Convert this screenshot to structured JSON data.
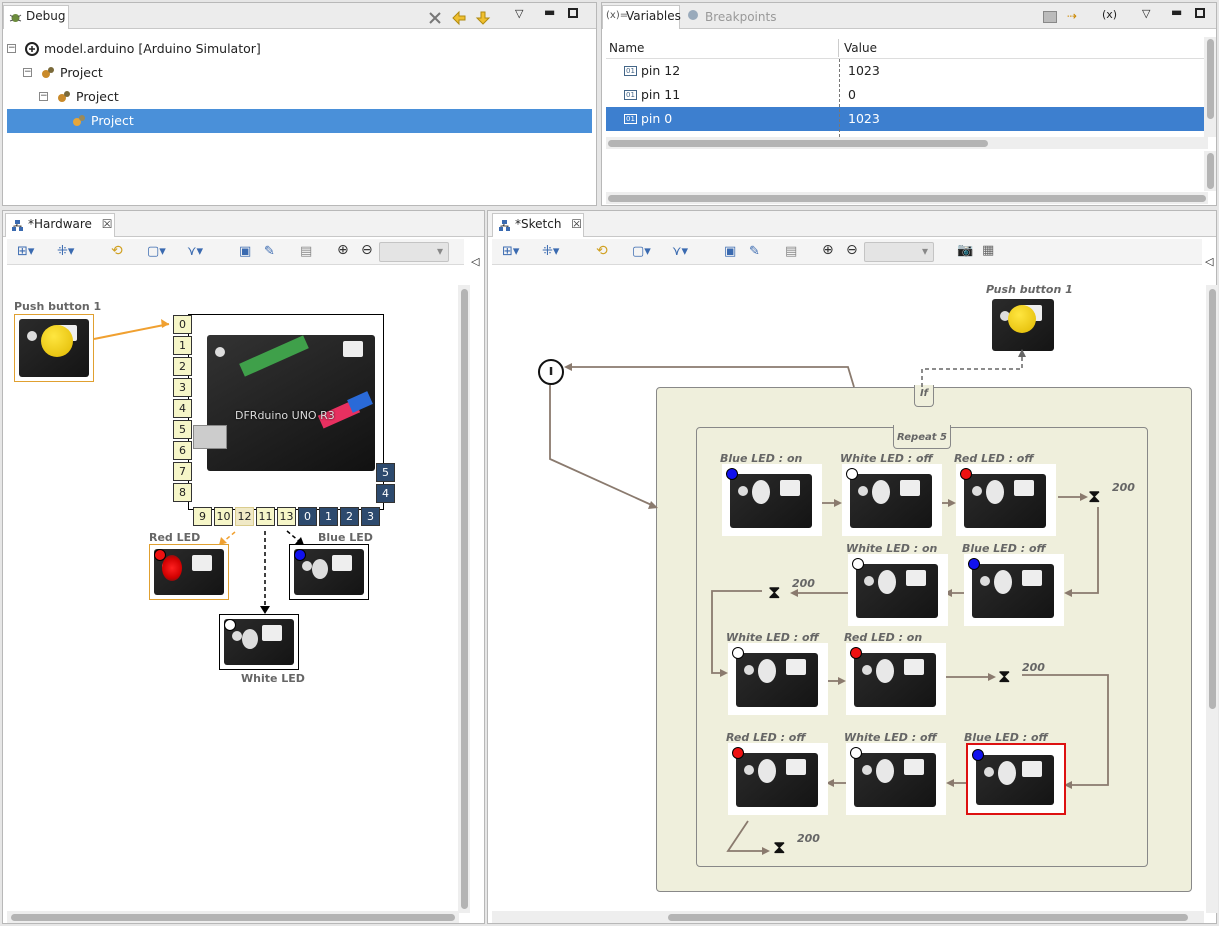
{
  "debug": {
    "tab_label": "Debug",
    "launch": "model.arduino [Arduino Simulator]",
    "tree": [
      "Project",
      "Project",
      "Project"
    ]
  },
  "variables": {
    "tab_label": "Variables",
    "tab2_label": "Breakpoints",
    "col_name": "Name",
    "col_value": "Value",
    "rows": [
      {
        "name": "pin 12",
        "value": "1023"
      },
      {
        "name": "pin 11",
        "value": "0"
      },
      {
        "name": "pin 0",
        "value": "1023"
      }
    ]
  },
  "hardware": {
    "tab_label": "*Hardware",
    "push_button": "Push button 1",
    "board_name": "DFRduino UNO R3",
    "left_pins": [
      "0",
      "1",
      "2",
      "3",
      "4",
      "5",
      "6",
      "7",
      "8"
    ],
    "bottom_pins": [
      "9",
      "10",
      "12",
      "11",
      "13",
      "0",
      "1",
      "2",
      "3"
    ],
    "right_pins": [
      "5",
      "4"
    ],
    "red_led": "Red LED",
    "blue_led": "Blue LED",
    "white_led": "White LED"
  },
  "sketch": {
    "tab_label": "*Sketch",
    "push_button": "Push button 1",
    "if_label": "If",
    "repeat_label": "Repeat 5",
    "steps": {
      "r1a": "Blue LED : on",
      "r1b": "White LED : off",
      "r1c": "Red LED : off",
      "r1wait": "200",
      "r2a": "White LED : on",
      "r2b": "Blue LED : off",
      "r2wait": "200",
      "r3a": "White LED : off",
      "r3b": "Red LED : on",
      "r3wait": "200",
      "r4a": "Red LED : off",
      "r4b": "White LED : off",
      "r4c": "Blue LED : off",
      "r4wait": "200"
    }
  },
  "colors": {
    "selection": "#4a90d9",
    "block_bg": "#efefdc",
    "arrow": "#8a7a6e",
    "pin_yellow": "#f6f6c8",
    "pin_dark": "#2d4a6e"
  }
}
